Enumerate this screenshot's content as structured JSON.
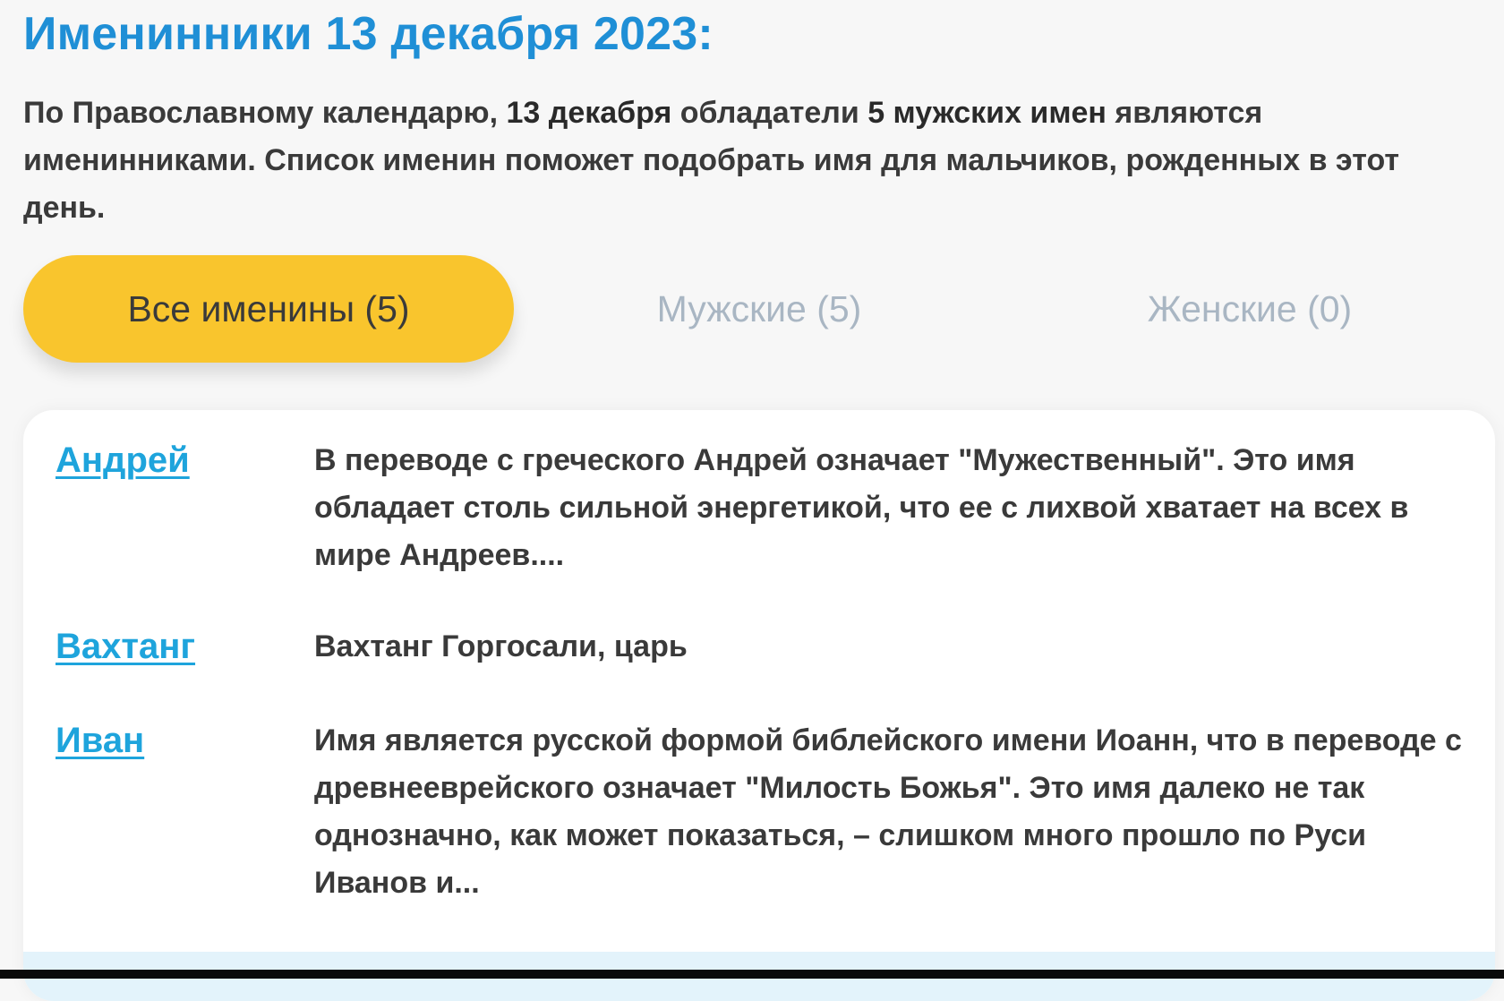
{
  "header": {
    "title": "Именинники 13 декабря 2023:"
  },
  "intro": {
    "part1": "По Православному календарю, ",
    "date_strong": "13 декабря",
    "part2": " обладатели ",
    "count_strong": "5 мужских имен",
    "part3": " являются именинниками. Список именин поможет подобрать имя для мальчиков, рожденных в этот день."
  },
  "tabs": [
    {
      "label": "Все именины (5)",
      "active": true
    },
    {
      "label": "Мужские (5)",
      "active": false
    },
    {
      "label": "Женские (0)",
      "active": false
    }
  ],
  "names": [
    {
      "name": "Андрей",
      "description": "В переводе с греческого Андрей означает \"Мужественный\". Это имя обладает столь сильной энергетикой, что ее с лихвой хватает на всех в мире Андреев...."
    },
    {
      "name": "Вахтанг",
      "description": "Вахтанг Горгосали, царь"
    },
    {
      "name": "Иван",
      "description": "Имя является русской формой библейского имени Иоанн, что в переводе с древнееврейского означает \"Милость Божья\". Это имя далеко не так однозначно, как может показаться, – слишком много прошло по Руси Иванов и..."
    }
  ],
  "colors": {
    "title": "#1f8fd6",
    "link": "#1ea4dc",
    "active_tab": "#f9c52d",
    "inactive_tab_text": "#a9b6c3",
    "body_text": "#3a3a3a",
    "page_bg": "#f7f7f7"
  }
}
